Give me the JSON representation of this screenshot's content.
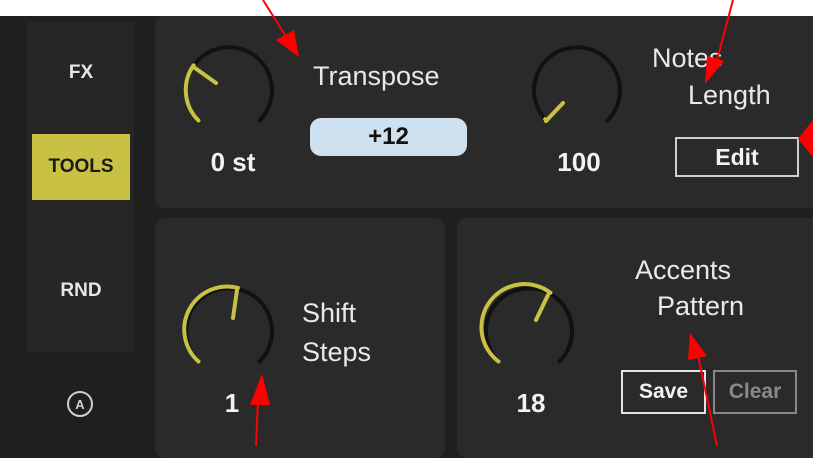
{
  "sidebar": {
    "items": [
      {
        "label": "FX",
        "active": false
      },
      {
        "label": "TOOLS",
        "active": true
      },
      {
        "label": "RND",
        "active": false
      }
    ],
    "auto_icon": "A"
  },
  "transpose": {
    "knob_value": "0 st",
    "title": "Transpose",
    "pill_value": "+12"
  },
  "notes_length": {
    "knob_value": "100",
    "title_line1": "Notes",
    "title_line2": "Length",
    "edit_label": "Edit"
  },
  "shift_steps": {
    "knob_value": "1",
    "title_line1": "Shift",
    "title_line2": "Steps"
  },
  "accents_pattern": {
    "knob_value": "18",
    "title_line1": "Accents",
    "title_line2": "Pattern",
    "save_label": "Save",
    "clear_label": "Clear"
  },
  "colors": {
    "accent": "#c9c143",
    "knob_track": "#111111",
    "panel": "#2a2a2a",
    "background": "#1f1f1f",
    "pill": "#cfe0ef",
    "arrow": "#ff0000"
  }
}
